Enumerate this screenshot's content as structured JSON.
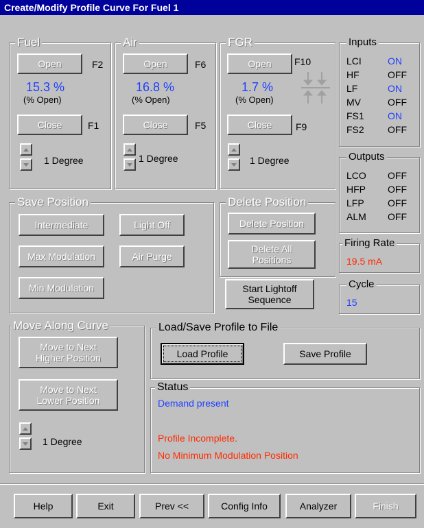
{
  "window": {
    "title": "Create/Modify Profile Curve For Fuel 1"
  },
  "fuel": {
    "legend": "Fuel",
    "open_label": "Open",
    "open_key": "F2",
    "percent": "15.3 %",
    "percent_caption": "(% Open)",
    "close_label": "Close",
    "close_key": "F1",
    "step_label": "1 Degree"
  },
  "air": {
    "legend": "Air",
    "open_label": "Open",
    "open_key": "F6",
    "percent": "16.8 %",
    "percent_caption": "(% Open)",
    "close_label": "Close",
    "close_key": "F5",
    "step_label": "1 Degree"
  },
  "fgr": {
    "legend": "FGR",
    "open_label": "Open",
    "open_key": "F10",
    "percent": "1.7 %",
    "percent_caption": "(% Open)",
    "close_label": "Close",
    "close_key": "F9",
    "step_label": "1 Degree"
  },
  "inputs": {
    "legend": "Inputs",
    "rows": [
      {
        "name": "LCI",
        "state": "ON"
      },
      {
        "name": "HF",
        "state": "OFF"
      },
      {
        "name": "LF",
        "state": "ON"
      },
      {
        "name": "MV",
        "state": "OFF"
      },
      {
        "name": "FS1",
        "state": "ON"
      },
      {
        "name": "FS2",
        "state": "OFF"
      }
    ]
  },
  "outputs": {
    "legend": "Outputs",
    "rows": [
      {
        "name": "LCO",
        "state": "OFF"
      },
      {
        "name": "HFP",
        "state": "OFF"
      },
      {
        "name": "LFP",
        "state": "OFF"
      },
      {
        "name": "ALM",
        "state": "OFF"
      }
    ]
  },
  "firing_rate": {
    "legend": "Firing Rate",
    "value": "19.5 mA"
  },
  "cycle": {
    "legend": "Cycle",
    "value": "15"
  },
  "save_position": {
    "legend": "Save Position",
    "intermediate": "Intermediate",
    "light_off": "Light Off",
    "max_modulation": "Max Modulation",
    "air_purge": "Air Purge",
    "min_modulation": "Min Modulation"
  },
  "delete_position": {
    "legend": "Delete Position",
    "delete_position": "Delete Position",
    "delete_all_line1": "Delete All",
    "delete_all_line2": "Positions"
  },
  "start_lightoff": {
    "line1": "Start Lightoff",
    "line2": "Sequence"
  },
  "move_along_curve": {
    "legend": "Move Along Curve",
    "next_higher_line1": "Move to Next",
    "next_higher_line2": "Higher Position",
    "next_lower_line1": "Move to Next",
    "next_lower_line2": "Lower Position",
    "step_label": "1 Degree"
  },
  "load_save": {
    "legend": "Load/Save Profile to File",
    "load_label": "Load Profile",
    "save_label": "Save Profile"
  },
  "status": {
    "legend": "Status",
    "line1": "Demand present",
    "line2": "Profile Incomplete.",
    "line3": "No Minimum Modulation Position"
  },
  "footer": {
    "help": "Help",
    "exit": "Exit",
    "prev": "Prev <<",
    "config_info": "Config Info",
    "analyzer": "Analyzer",
    "finish": "Finish"
  },
  "colors": {
    "on": "#1f3fff",
    "off": "#000000",
    "alert": "#ff2a00",
    "title_bg": "#00009a"
  }
}
